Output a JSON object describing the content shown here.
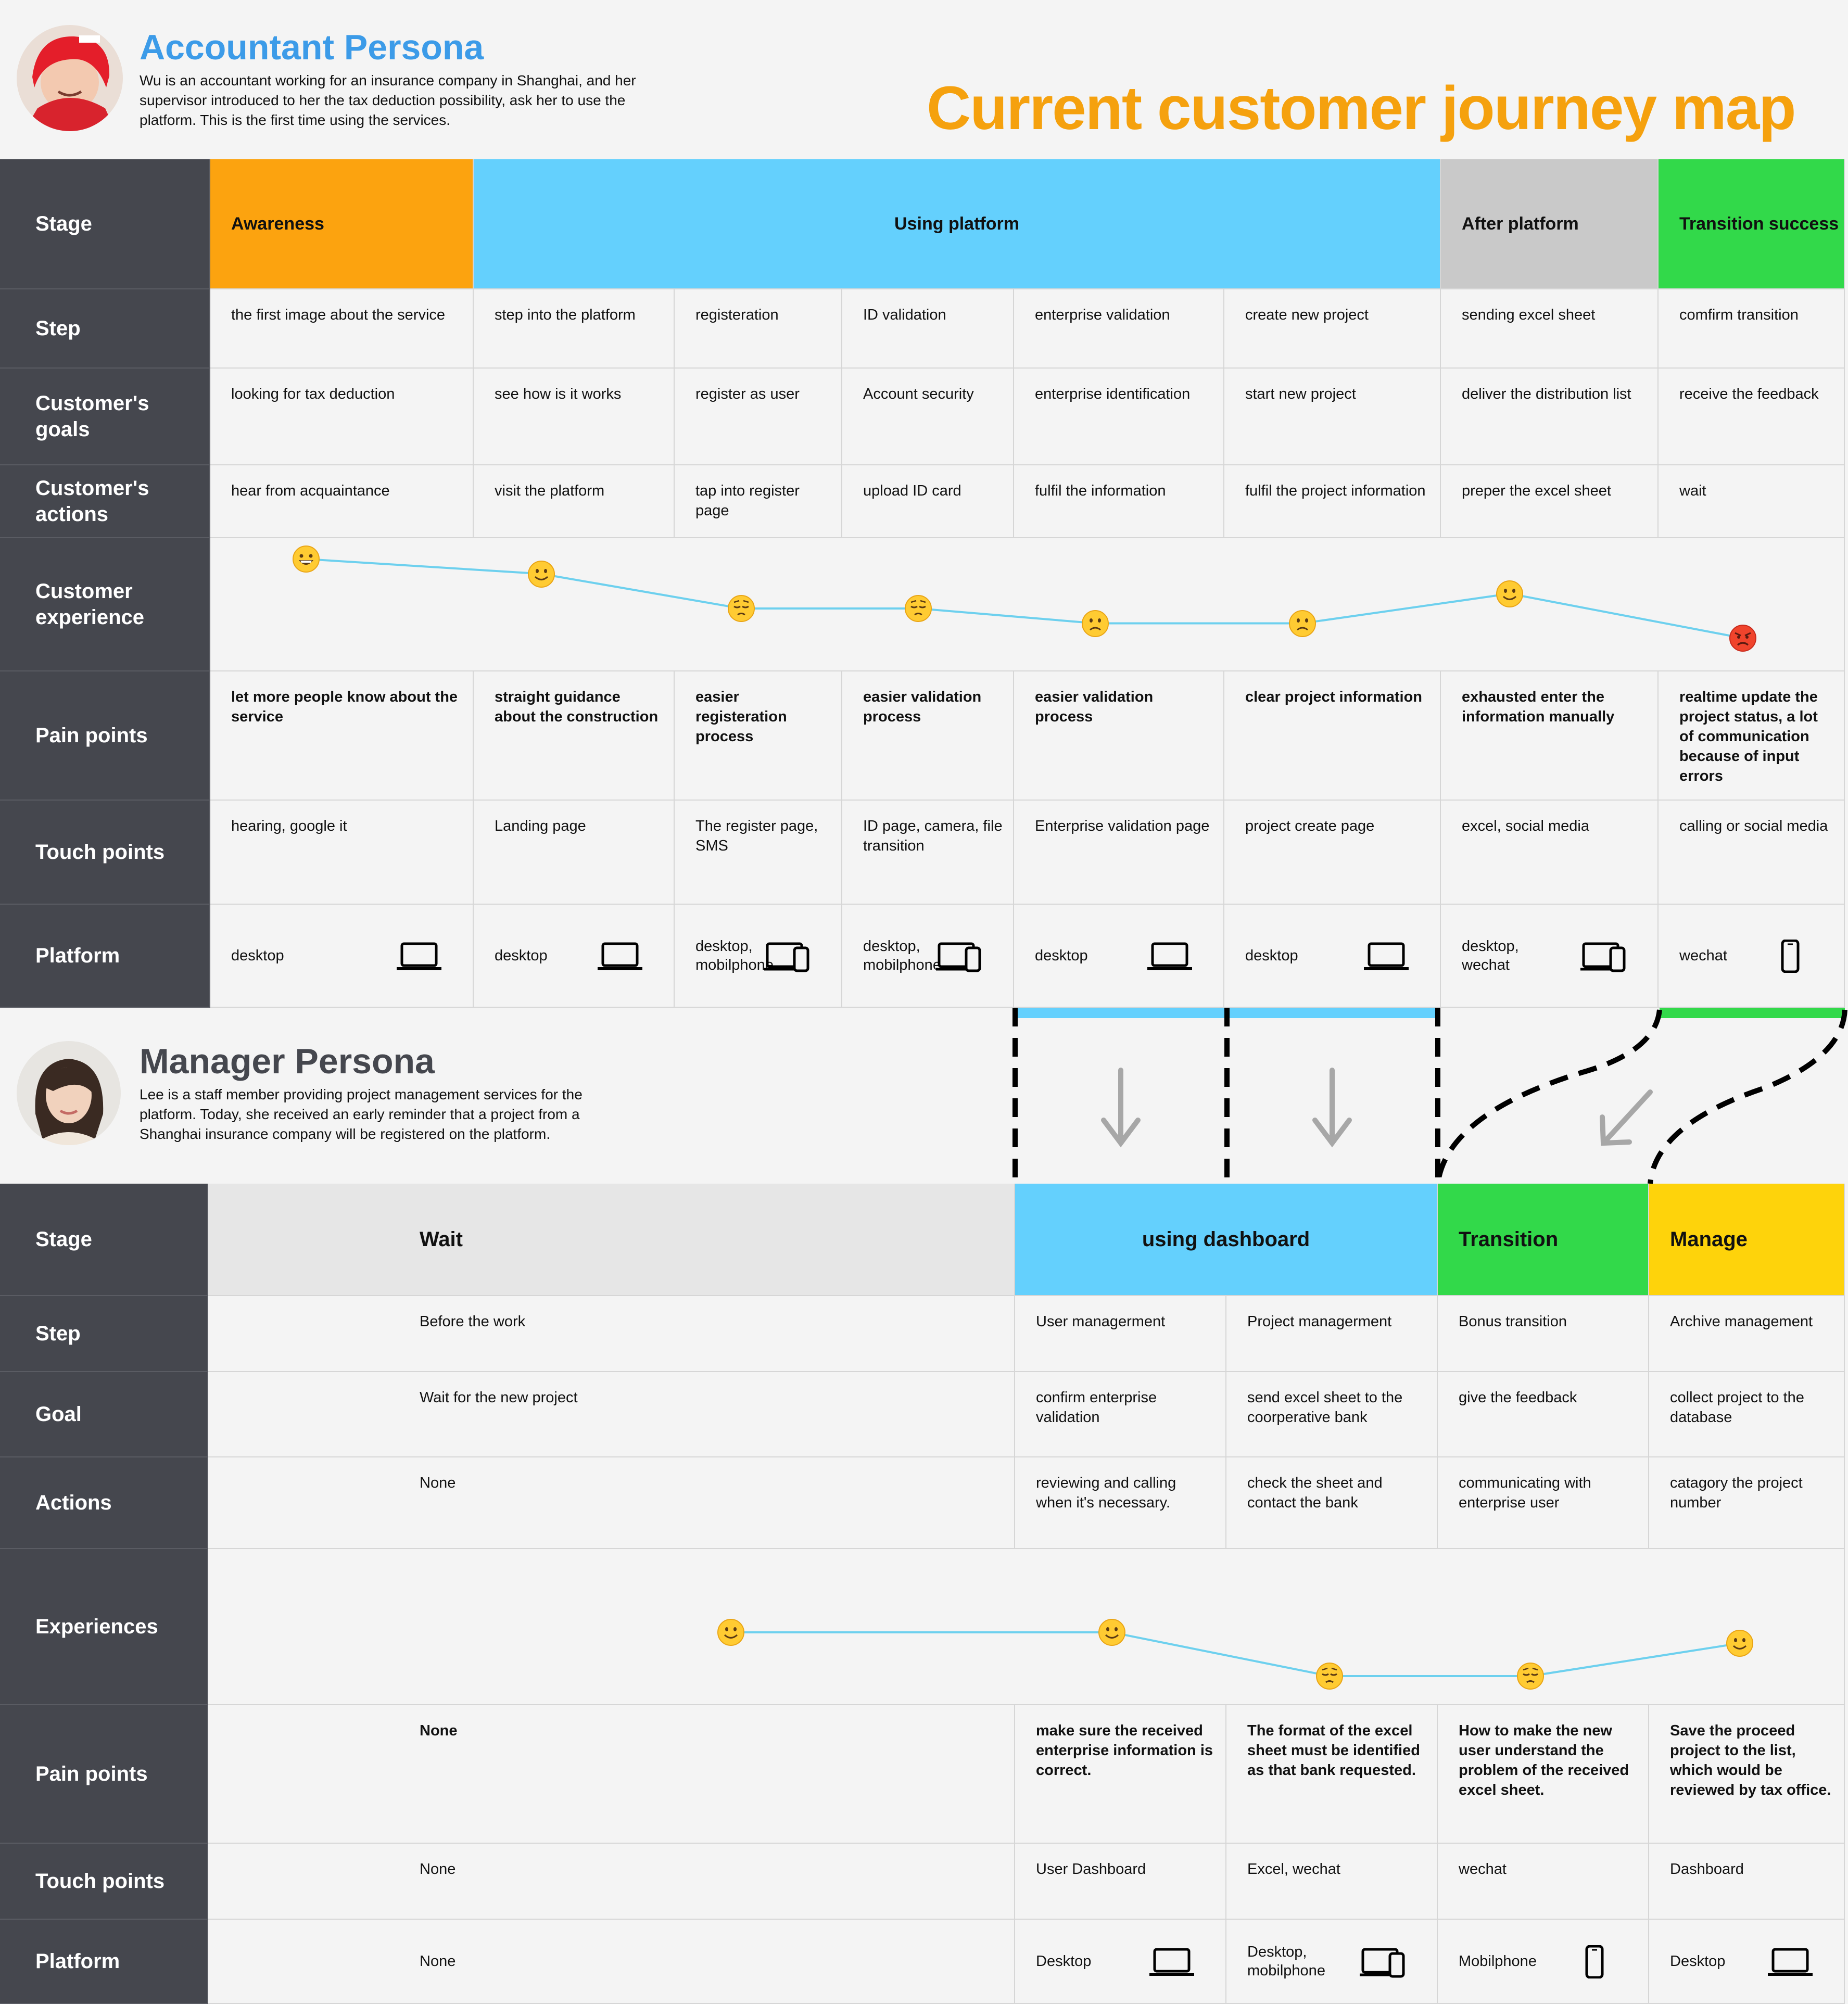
{
  "accountant": {
    "name": "Accountant Persona",
    "desc": "Wu is an accountant working for an insurance company in Shanghai, and her supervisor introduced to her the tax deduction possibility, ask her to use the platform. This is the first time using the services."
  },
  "title": "Current customer journey map",
  "journey1": {
    "row_labels": {
      "stage": "Stage",
      "step": "Step",
      "goals": "Customer's goals",
      "actions": "Customer's actions",
      "experience": "Customer experience",
      "pain": "Pain points",
      "touch": "Touch points",
      "platform": "Platform"
    },
    "stages": [
      "Awareness",
      "Using platform",
      "After platform",
      "Transition success"
    ],
    "steps": [
      "the first image about the service",
      "step into the platform",
      "registeration",
      "ID validation",
      "enterprise validation",
      "create new project",
      "sending excel sheet",
      "comfirm transition"
    ],
    "goals": [
      "looking for tax deduction",
      "see how is it works",
      "register as user",
      "Account security",
      "enterprise identification",
      "start new project",
      "deliver the distribution list",
      "receive the feedback"
    ],
    "actions": [
      "hear from acquaintance",
      "visit the platform",
      "tap into register page",
      "upload ID card",
      "fulfil the information",
      "fulfil the project information",
      "preper the excel sheet",
      "wait"
    ],
    "pain": [
      "let more people know about the service",
      "straight guidance about the construction",
      "easier registeration process",
      "easier validation process",
      "easier validation process",
      "clear project information",
      "exhausted enter the information manually",
      "realtime update the project status, a lot of communication because of input errors"
    ],
    "touch": [
      "hearing, google it",
      "Landing page",
      "The register page, SMS",
      "ID page, camera, file transition",
      "Enterprise validation page",
      "project create page",
      "excel, social media",
      "calling or social media"
    ],
    "platform": [
      "desktop",
      "desktop",
      "desktop, mobilphone",
      "desktop, mobilphone",
      "desktop",
      "desktop",
      "desktop, wechat",
      "wechat"
    ],
    "platform_icons": [
      "laptop-icon",
      "laptop-icon",
      "devices-icon",
      "devices-icon",
      "laptop-icon",
      "laptop-icon",
      "devices-icon",
      "phone-icon"
    ],
    "experience": [
      {
        "mood": "grinning",
        "level": 0.0
      },
      {
        "mood": "smile",
        "level": 0.15
      },
      {
        "mood": "pensive",
        "level": 0.5
      },
      {
        "mood": "pensive",
        "level": 0.5
      },
      {
        "mood": "frown",
        "level": 0.65
      },
      {
        "mood": "frown",
        "level": 0.65
      },
      {
        "mood": "smile",
        "level": 0.35
      },
      {
        "mood": "angry",
        "level": 0.8
      }
    ]
  },
  "manager": {
    "name": "Manager Persona",
    "desc": "Lee is a staff member providing project management services for the platform. Today, she received an early reminder that a project from a Shanghai insurance company will be registered on the platform."
  },
  "journey2": {
    "row_labels": {
      "stage": "Stage",
      "step": "Step",
      "goal": "Goal",
      "actions": "Actions",
      "experience": "Experiences",
      "pain": "Pain points",
      "touch": "Touch points",
      "platform": "Platform"
    },
    "stages": [
      "Wait",
      "using dashboard",
      "Transition",
      "Manage"
    ],
    "steps": [
      "Before the work",
      "User managerment",
      "Project managerment",
      "Bonus transition",
      "Archive management"
    ],
    "goals": [
      "Wait for the new project",
      "confirm enterprise validation",
      "send excel sheet to the coorperative bank",
      "give the feedback",
      "collect project to the database"
    ],
    "actions": [
      "None",
      "reviewing and calling when it's necessary.",
      "check the sheet and contact the bank",
      "communicating with enterprise user",
      "catagory the project number"
    ],
    "pain": [
      "None",
      "make sure the received enterprise information is correct.",
      "The format of the excel sheet must be identified as that bank requested.",
      "How to make the new user understand the problem of the received excel sheet.",
      "Save the proceed project to the list, which would be reviewed by tax office."
    ],
    "touch": [
      "None",
      "User Dashboard",
      "Excel, wechat",
      "wechat",
      "Dashboard"
    ],
    "platform": [
      "None",
      "Desktop",
      "Desktop, mobilphone",
      "Mobilphone",
      "Desktop"
    ],
    "platform_icons": [
      "",
      "laptop-icon",
      "devices-icon",
      "phone-icon",
      "laptop-icon"
    ],
    "experience": [
      {
        "mood": "smile",
        "level": 0.0
      },
      {
        "mood": "smile",
        "level": 0.0
      },
      {
        "mood": "pensive",
        "level": 1.0
      },
      {
        "mood": "pensive",
        "level": 1.0
      },
      {
        "mood": "smile",
        "level": 0.25
      }
    ]
  },
  "colors": {
    "awareness": "#fca30f",
    "using": "#64d0fd",
    "after": "#c9c9c9",
    "transition": "#32d94a",
    "wait": "#e6e6e6",
    "manage": "#fed30b",
    "header": "#45474e",
    "title": "#f5a10e",
    "persona_title": "#3c9be8",
    "line": "#6dd0ee"
  }
}
